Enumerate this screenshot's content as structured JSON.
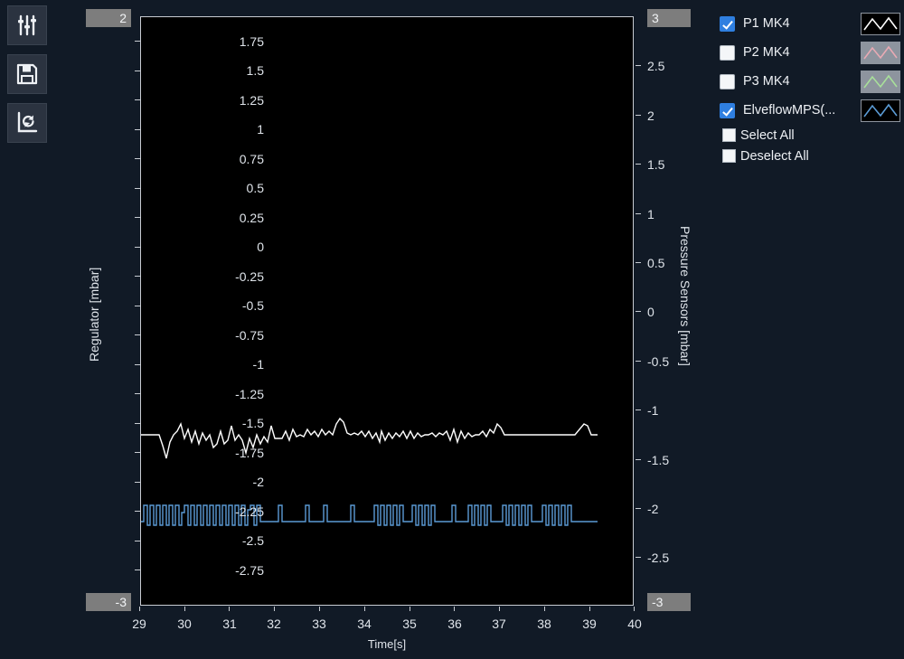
{
  "window": {
    "background": "#111a26",
    "plot_background": "#000000"
  },
  "toolbar": {
    "buttons": [
      {
        "name": "settings-sliders-button",
        "icon": "sliders-icon",
        "tooltip": "Settings"
      },
      {
        "name": "save-button",
        "icon": "floppy-disk-icon",
        "tooltip": "Save"
      },
      {
        "name": "refresh-plot-button",
        "icon": "refresh-axes-icon",
        "tooltip": "Reset plot"
      }
    ]
  },
  "plot": {
    "left_axis": {
      "title": "Regulator [mbar]",
      "max_field": "2",
      "min_field": "-3",
      "ticks": [
        "2",
        "1.75",
        "1.5",
        "1.25",
        "1",
        "0.75",
        "0.5",
        "0.25",
        "0",
        "-0.25",
        "-0.5",
        "-0.75",
        "-1",
        "-1.25",
        "-1.5",
        "-1.75",
        "-2",
        "-2.25",
        "-2.5",
        "-2.75",
        "-3"
      ]
    },
    "right_axis": {
      "title": "Pressure Sensors [mbar]",
      "max_field": "3",
      "min_field": "-3",
      "ticks": [
        "3",
        "2.5",
        "2",
        "1.5",
        "1",
        "0.5",
        "0",
        "-0.5",
        "-1",
        "-1.5",
        "-2",
        "-2.5",
        "-3"
      ]
    },
    "x_axis": {
      "title": "Time[s]",
      "ticks": [
        "29",
        "30",
        "31",
        "32",
        "33",
        "34",
        "35",
        "36",
        "37",
        "38",
        "39",
        "40"
      ]
    }
  },
  "legend": {
    "series": [
      {
        "name": "legend-item-p1-mk4",
        "label": "P1 MK4",
        "checked": true,
        "color": "#ffffff",
        "thumb_bg": "#000000"
      },
      {
        "name": "legend-item-p2-mk4",
        "label": "P2 MK4",
        "checked": false,
        "color": "#e8aab4",
        "thumb_bg": "#8d949e"
      },
      {
        "name": "legend-item-p3-mk4",
        "label": "P3 MK4",
        "checked": false,
        "color": "#a8e09a",
        "thumb_bg": "#8d949e"
      },
      {
        "name": "legend-item-elveflow",
        "label": "ElveflowMPS(...",
        "checked": true,
        "color": "#5b9bd5",
        "thumb_bg": "#000000"
      }
    ],
    "select_all_label": "Select All",
    "deselect_all_label": "Deselect All",
    "select_all_checked": false,
    "deselect_all_checked": false
  },
  "chart_data": {
    "type": "line",
    "title": "",
    "xlabel": "Time[s]",
    "ylabel": "Regulator [mbar]",
    "y2label": "Pressure Sensors [mbar]",
    "xlim": [
      29,
      40
    ],
    "ylim": [
      -3,
      2
    ],
    "y2lim": [
      -3,
      3
    ],
    "grid": false,
    "legend_position": "right",
    "series": [
      {
        "name": "P1 MK4",
        "axis": "left",
        "color": "#ffffff",
        "visible": true,
        "description": "Noisy regulator signal oscillating around -1.5 mbar with small step fluctuations",
        "x": [
          29.0,
          29.1,
          29.2,
          29.3,
          29.4,
          29.5,
          29.6,
          29.7,
          29.8,
          29.9,
          30.0,
          30.1,
          30.2,
          30.3,
          30.4,
          30.5,
          30.6,
          30.7,
          30.8,
          30.9,
          31.0,
          31.1,
          31.2,
          31.3,
          31.4,
          31.5,
          31.6,
          31.7,
          31.8,
          31.9,
          32.0,
          32.1,
          32.2,
          32.3,
          32.4,
          32.5,
          32.6,
          32.7,
          32.8,
          32.9,
          33.0,
          33.1,
          33.2,
          33.3,
          33.4,
          33.5,
          33.6,
          33.7,
          33.8,
          33.9,
          34.0,
          34.1,
          34.2,
          34.3,
          34.4,
          34.5,
          34.6,
          34.7,
          34.8,
          34.9,
          35.0,
          35.1,
          35.2,
          35.3,
          35.4,
          35.5,
          35.6,
          35.7,
          35.8,
          35.9,
          36.0,
          36.1,
          36.2,
          36.3,
          36.4,
          36.5,
          36.6,
          36.7,
          36.8,
          36.9,
          37.0,
          37.1,
          37.2,
          37.3,
          37.4,
          37.5,
          37.6,
          37.7,
          37.8,
          37.9,
          38.0,
          38.1,
          38.2,
          38.3,
          38.4,
          38.5,
          38.6,
          38.7,
          38.8,
          38.9,
          39.0
        ],
        "y": [
          -1.52,
          -1.52,
          -1.52,
          -1.52,
          -1.52,
          -1.52,
          -1.74,
          -1.62,
          -1.49,
          -1.57,
          -1.42,
          -1.55,
          -1.47,
          -1.58,
          -1.46,
          -1.57,
          -1.5,
          -1.6,
          -1.58,
          -1.48,
          -1.58,
          -1.56,
          -1.44,
          -1.56,
          -1.52,
          -1.56,
          -1.66,
          -1.54,
          -1.6,
          -1.5,
          -1.58,
          -1.53,
          -1.57,
          -1.44,
          -1.55,
          -1.55,
          -1.55,
          -1.5,
          -1.56,
          -1.48,
          -1.54,
          -1.52,
          -1.54,
          -1.48,
          -1.53,
          -1.5,
          -1.54,
          -1.49,
          -1.53,
          -1.5,
          -1.53,
          -1.45,
          -1.42,
          -1.44,
          -1.52,
          -1.53,
          -1.52,
          -1.53,
          -1.51,
          -1.54,
          -1.5,
          -1.55,
          -1.51,
          -1.57,
          -1.49,
          -1.56,
          -1.5,
          -1.55,
          -1.51,
          -1.54,
          -1.5,
          -1.55,
          -1.5,
          -1.55,
          -1.51,
          -1.54,
          -1.52,
          -1.53,
          -1.52,
          -1.54,
          -1.52,
          -1.53,
          -1.51,
          -1.55,
          -1.5,
          -1.56,
          -1.5,
          -1.55,
          -1.51,
          -1.54,
          -1.52,
          -1.53,
          -1.51,
          -1.54,
          -1.5,
          -1.52,
          -1.46,
          -1.48,
          -1.52,
          -1.52,
          -1.52
        ]
      },
      {
        "name": "ElveflowMPS(...",
        "axis": "right",
        "color": "#5b9bd5",
        "visible": true,
        "description": "Square-wave pulse train alternating between about -2.35 and -2.15 mbar, with dense burst regions and sparse single pulses",
        "baseline": -2.35,
        "peak": -2.12,
        "pulse_bursts": [
          {
            "start": 29.05,
            "end": 31.95,
            "density": "dense"
          },
          {
            "start": 32.35,
            "end": 32.55,
            "density": "single"
          },
          {
            "start": 32.95,
            "end": 33.55,
            "density": "sparse"
          },
          {
            "start": 34.15,
            "end": 34.35,
            "density": "single"
          },
          {
            "start": 34.75,
            "end": 35.75,
            "density": "dense"
          },
          {
            "start": 36.05,
            "end": 36.35,
            "density": "single"
          },
          {
            "start": 36.65,
            "end": 37.95,
            "density": "dense"
          },
          {
            "start": 38.15,
            "end": 38.95,
            "density": "dense"
          }
        ]
      },
      {
        "name": "P2 MK4",
        "axis": "right",
        "color": "#e8aab4",
        "visible": false,
        "x": [],
        "y": []
      },
      {
        "name": "P3 MK4",
        "axis": "right",
        "color": "#a8e09a",
        "visible": false,
        "x": [],
        "y": []
      }
    ]
  }
}
